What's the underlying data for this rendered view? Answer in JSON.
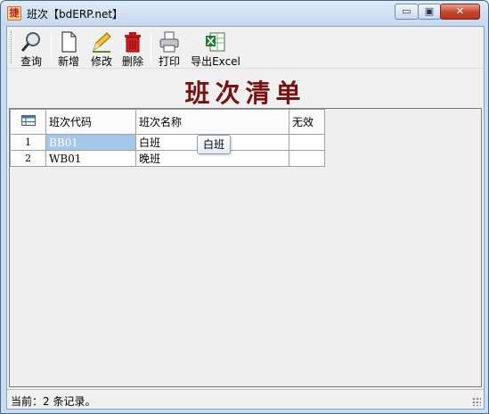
{
  "window": {
    "title": "班次【bdERP.net】",
    "app_icon_glyph": "捷",
    "min_glyph": "▭",
    "max_glyph": "▣",
    "close_glyph": "✕"
  },
  "toolbar": {
    "query_label": "查询",
    "new_label": "新增",
    "edit_label": "修改",
    "delete_label": "删除",
    "print_label": "打印",
    "export_label": "导出Excel"
  },
  "banner": {
    "title": "班次清单"
  },
  "grid": {
    "columns": [
      "班次代码",
      "班次名称",
      "无效"
    ],
    "rows": [
      {
        "num": "1",
        "code": "BB01",
        "name": "白班",
        "invalid": ""
      },
      {
        "num": "2",
        "code": "WB01",
        "name": "晚班",
        "invalid": ""
      }
    ],
    "tooltip": "白班"
  },
  "status": {
    "text": "当前：2 条记录。"
  },
  "colors": {
    "banner": "#7a1010",
    "selected": "#a6c7ec",
    "close": "#c4432b"
  }
}
